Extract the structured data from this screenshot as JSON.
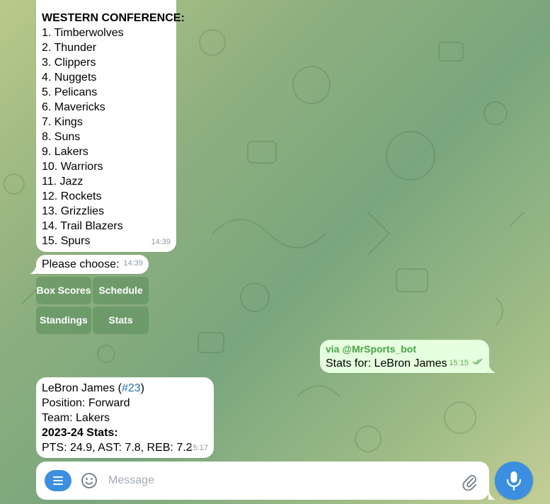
{
  "colors": {
    "accent": "#3c8fe0",
    "outgoing_bubble": "#e6ffde",
    "incoming_bubble": "#ffffff",
    "keyboard_button": "#5a8c5a",
    "link": "#2a6fb0",
    "via_bot": "#4aa14a"
  },
  "standings": {
    "header": "WESTERN CONFERENCE:",
    "teams": [
      "1. Timberwolves",
      "2. Thunder",
      "3. Clippers",
      "4. Nuggets",
      "5. Pelicans",
      "6. Mavericks",
      "7. Kings",
      "8. Suns",
      "9. Lakers",
      "10. Warriors",
      "11. Jazz",
      "12. Rockets",
      "13. Grizzlies",
      "14. Trail Blazers",
      "15. Spurs"
    ],
    "time": "14:39"
  },
  "prompt": {
    "text": "Please choose:",
    "time": "14:39"
  },
  "keyboard": {
    "box_scores": "Box Scores",
    "schedule": "Schedule",
    "standings": "Standings",
    "stats": "Stats"
  },
  "sent_message": {
    "via": "via @MrSports_bot",
    "text": "Stats for: LeBron James",
    "time": "15:15",
    "status_icon": "double-check-icon"
  },
  "player_card": {
    "name_prefix": "LeBron James (",
    "number_link": "#23",
    "name_suffix": ")",
    "position": "Position: Forward",
    "team": "Team: Lakers",
    "stats_header": "2023-24 Stats:",
    "stats_line": "PTS: 24.9, AST: 7.8, REB: 7.2",
    "time": "15:17"
  },
  "composer": {
    "placeholder": "Message",
    "menu_icon": "menu-icon",
    "emoji_icon": "emoji-icon",
    "attach_icon": "paperclip-icon",
    "mic_icon": "microphone-icon"
  }
}
